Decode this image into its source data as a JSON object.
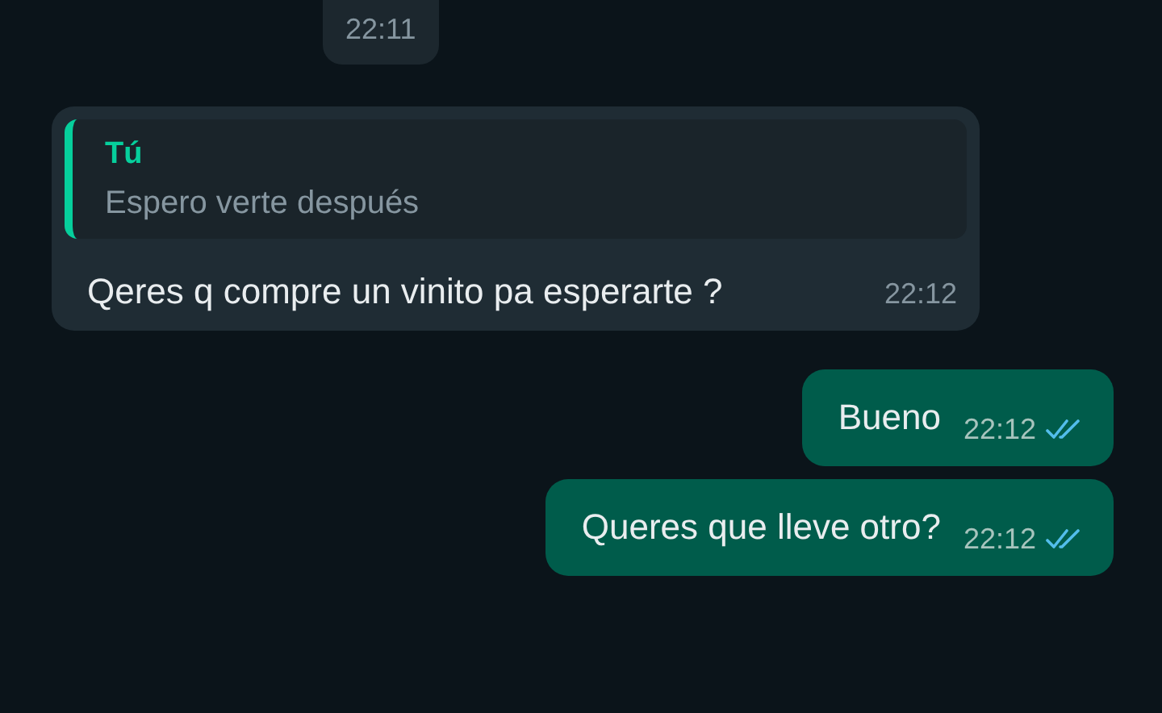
{
  "date_pill": {
    "text": "22:11"
  },
  "messages": [
    {
      "kind": "incoming",
      "quote": {
        "author": "Tú",
        "text": "Espero verte después"
      },
      "text": "Qeres q compre un vinito pa esperarte ?",
      "time": "22:12"
    },
    {
      "kind": "outgoing",
      "text": "Bueno",
      "time": "22:12",
      "read": true
    },
    {
      "kind": "outgoing",
      "text": "Queres que lleve otro?",
      "time": "22:12",
      "read": true
    }
  ]
}
